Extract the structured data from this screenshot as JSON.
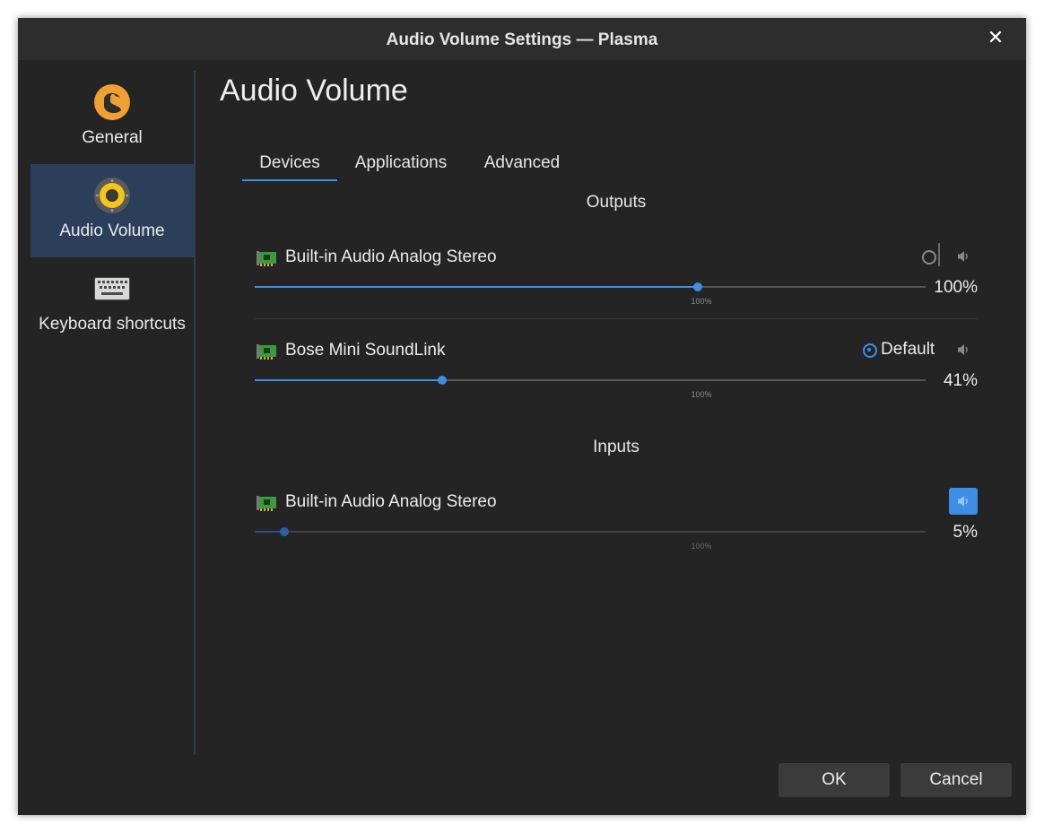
{
  "window": {
    "title": "Audio Volume Settings — Plasma",
    "close_icon": "close-icon"
  },
  "sidebar": {
    "items": [
      {
        "label": "General",
        "icon": "general-settings-icon",
        "active": false
      },
      {
        "label": "Audio Volume",
        "icon": "speaker-icon",
        "active": true
      },
      {
        "label": "Keyboard shortcuts",
        "icon": "keyboard-icon",
        "active": false
      }
    ]
  },
  "page": {
    "title": "Audio Volume"
  },
  "tabs": [
    {
      "label": "Devices",
      "active": true
    },
    {
      "label": "Applications",
      "active": false
    },
    {
      "label": "Advanced",
      "active": false
    }
  ],
  "outputs": {
    "title": "Outputs",
    "devices": [
      {
        "name": "Built-in Audio Analog Stereo",
        "volume_percent": 100,
        "volume_label": "100%",
        "hundred_mark": "100%",
        "default": false,
        "muted": false,
        "icon": "sound-card-icon"
      },
      {
        "name": "Bose Mini SoundLink",
        "volume_percent": 41,
        "volume_label": "41%",
        "hundred_mark": "100%",
        "default": true,
        "default_label": "Default",
        "muted": false,
        "icon": "sound-card-icon"
      }
    ]
  },
  "inputs": {
    "title": "Inputs",
    "devices": [
      {
        "name": "Built-in Audio Analog Stereo",
        "volume_percent": 5,
        "volume_label": "5%",
        "hundred_mark": "100%",
        "muted": true,
        "icon": "sound-card-icon"
      }
    ]
  },
  "buttons": {
    "ok": "OK",
    "cancel": "Cancel"
  },
  "colors": {
    "accent": "#3d8ee6",
    "window_bg": "#242424",
    "titlebar_bg": "#2d2d2d",
    "sidebar_active": "#2c3f5a",
    "button_bg": "#3b3b3b"
  }
}
